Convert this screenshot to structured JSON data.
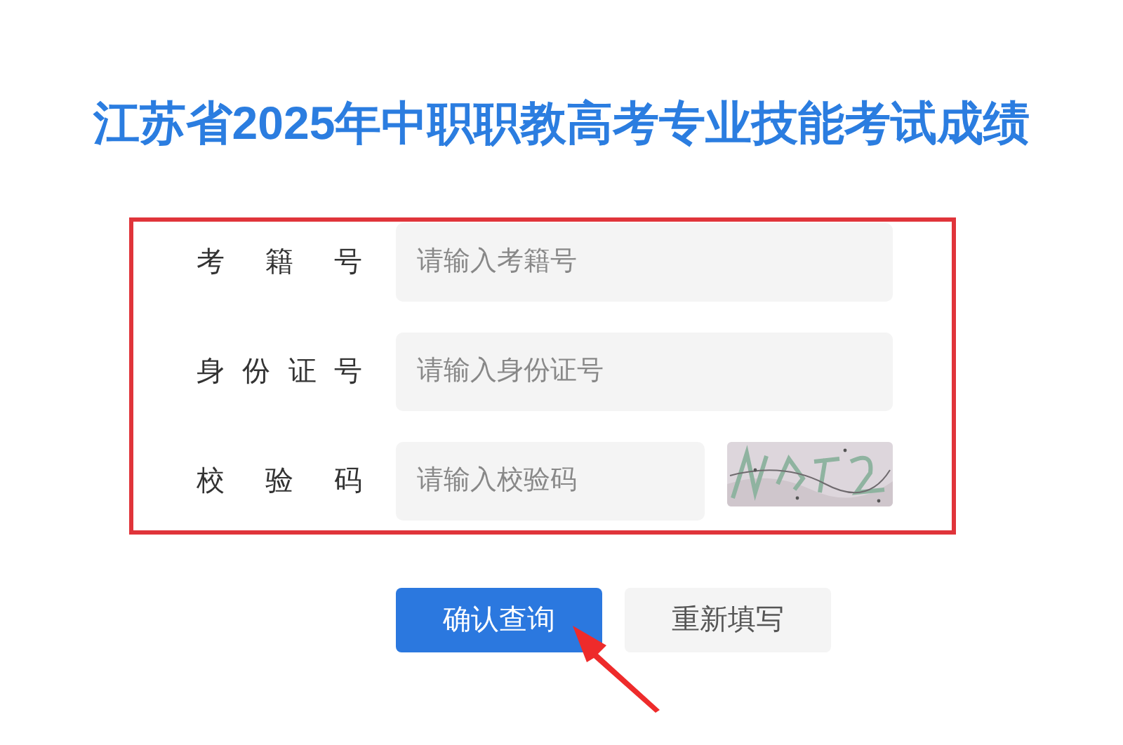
{
  "title": "江苏省2025年中职职教高考专业技能考试成绩",
  "form": {
    "fields": [
      {
        "kind": "text",
        "label": "考籍号",
        "placeholder": "请输入考籍号"
      },
      {
        "kind": "text",
        "label": "身份证号",
        "placeholder": "请输入身份证号"
      },
      {
        "kind": "captcha",
        "label": "校验码",
        "placeholder": "请输入校验码"
      }
    ]
  },
  "buttons": [
    {
      "label": "确认查询",
      "kind": "primary"
    },
    {
      "label": "重新填写",
      "kind": "secondary"
    }
  ]
}
